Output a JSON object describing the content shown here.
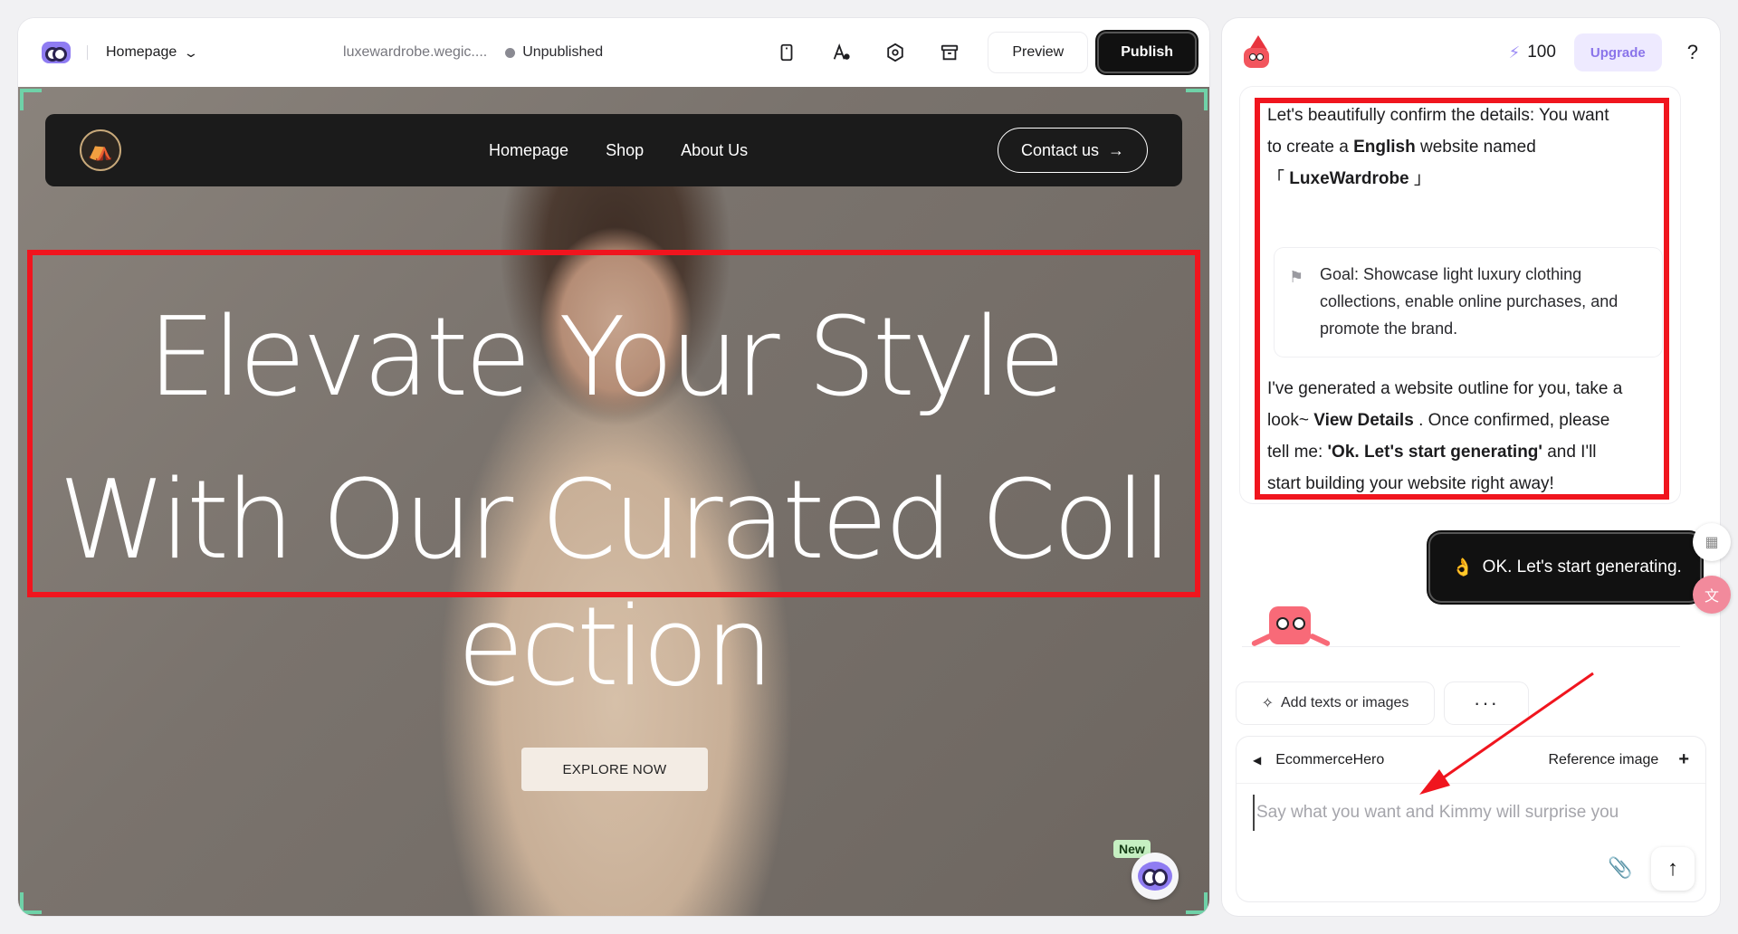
{
  "editor": {
    "page_name": "Homepage",
    "domain": "luxewardrobe.wegic....",
    "status": "Unpublished",
    "tools": [
      "mobile-icon",
      "text-style-icon",
      "settings-icon",
      "archive-icon"
    ],
    "preview_label": "Preview",
    "publish_label": "Publish"
  },
  "site": {
    "nav": [
      "Homepage",
      "Shop",
      "About Us"
    ],
    "contact_label": "Contact us",
    "hero_line1": "Elevate Your Style",
    "hero_line2": "With Our Curated Coll",
    "hero_line3": "ection",
    "cta_label": "EXPLORE NOW",
    "new_badge": "New"
  },
  "chat": {
    "credits": "100",
    "upgrade_label": "Upgrade",
    "help": "?",
    "message": {
      "p1_a": "Let's beautifully confirm the details: You want",
      "p1_b_pre": "to create a ",
      "p1_b_bold": "English",
      "p1_b_post": " website named",
      "p1_c_open": "「",
      "p1_c_bold": "LuxeWardrobe",
      "p1_c_close": "」",
      "goal": "Goal: Showcase light luxury clothing collections, enable online purchases, and promote the brand.",
      "p2_a": "I've generated a website outline for you, take a",
      "p2_b_pre": "look~ ",
      "p2_b_bold": "View Details",
      "p2_b_post": " . Once confirmed, please",
      "p2_c_pre": "tell me: ",
      "p2_c_bold": "'Ok. Let's start generating'",
      "p2_c_post": " and I'll",
      "p2_d": "start building your website right away!"
    },
    "user_reply": "OK. Let's start generating.",
    "user_reply_emoji": "👌",
    "add_chip_label": "Add texts or images",
    "more_chip_label": "···",
    "agent_name": "EcommerceHero",
    "reference_label": "Reference image",
    "reference_plus": "+",
    "input_placeholder": "Say what you want and Kimmy will surprise you"
  },
  "colors": {
    "accent_purple": "#8f7cf2",
    "annotation_red": "#f0151e",
    "publish_bg": "#111111",
    "corner_green": "#6fd2a8"
  }
}
